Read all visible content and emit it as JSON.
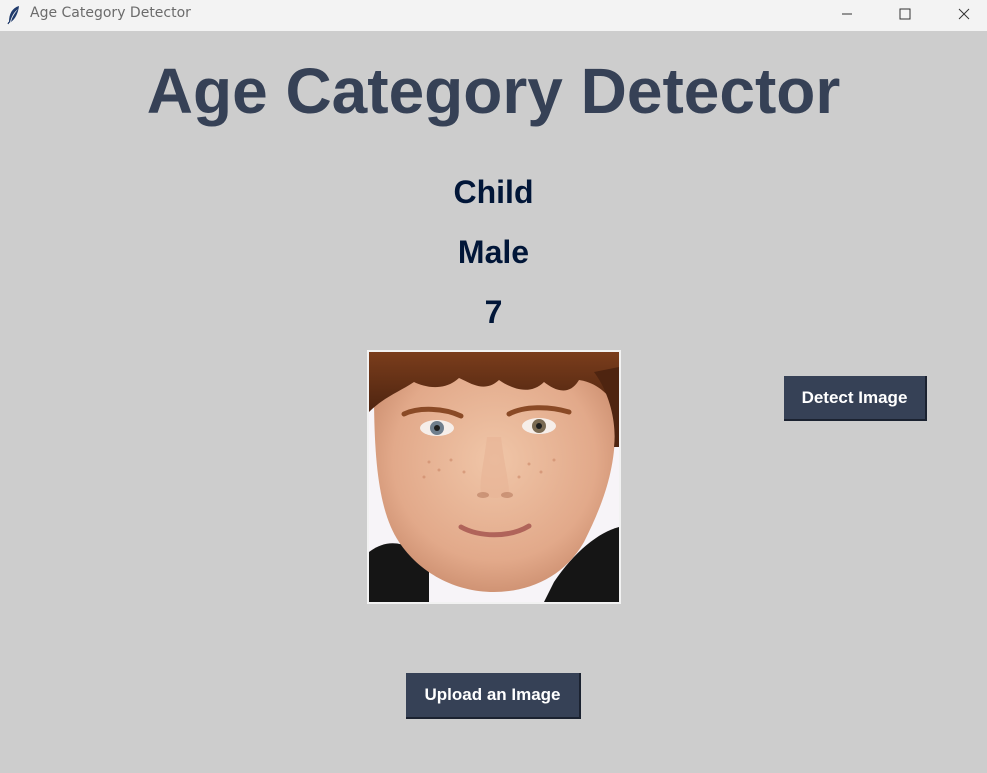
{
  "window": {
    "title": "Age Category Detector",
    "icon": "feather-icon",
    "controls": [
      "minimize-icon",
      "maximize-icon",
      "close-icon"
    ]
  },
  "main": {
    "heading": "Age Category Detector",
    "result": {
      "category": "Child",
      "gender": "Male",
      "age": "7"
    },
    "photo": {
      "subject": "face-photo"
    },
    "buttons": {
      "detect_label": "Detect Image",
      "upload_label": "Upload an Image"
    }
  },
  "colors": {
    "background": "#cdcdcd",
    "heading": "#364156",
    "result_text": "#011638",
    "button_bg": "#364156",
    "button_text": "#ffffff"
  }
}
